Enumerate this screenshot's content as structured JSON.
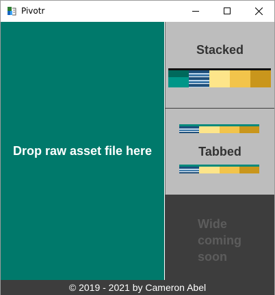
{
  "window": {
    "title": "Pivotr",
    "icon": "pivotr-app-icon",
    "controls": {
      "minimize": "minimize-icon",
      "maximize": "maximize-icon",
      "close": "close-icon"
    }
  },
  "drop_zone": {
    "label": "Drop raw asset file here",
    "color": "#00796b"
  },
  "layouts": [
    {
      "label": "Stacked",
      "colors": [
        "#00796b",
        "#1e4f7a",
        "#fde58a",
        "#f2c44b",
        "#c9961c"
      ]
    },
    {
      "label": "Tabbed"
    },
    {
      "label": "Wide coming soon",
      "lines": [
        "Wide",
        "coming",
        "soon"
      ],
      "disabled": true
    }
  ],
  "footer": {
    "text": "© 2019 - 2021 by Cameron Abel"
  }
}
